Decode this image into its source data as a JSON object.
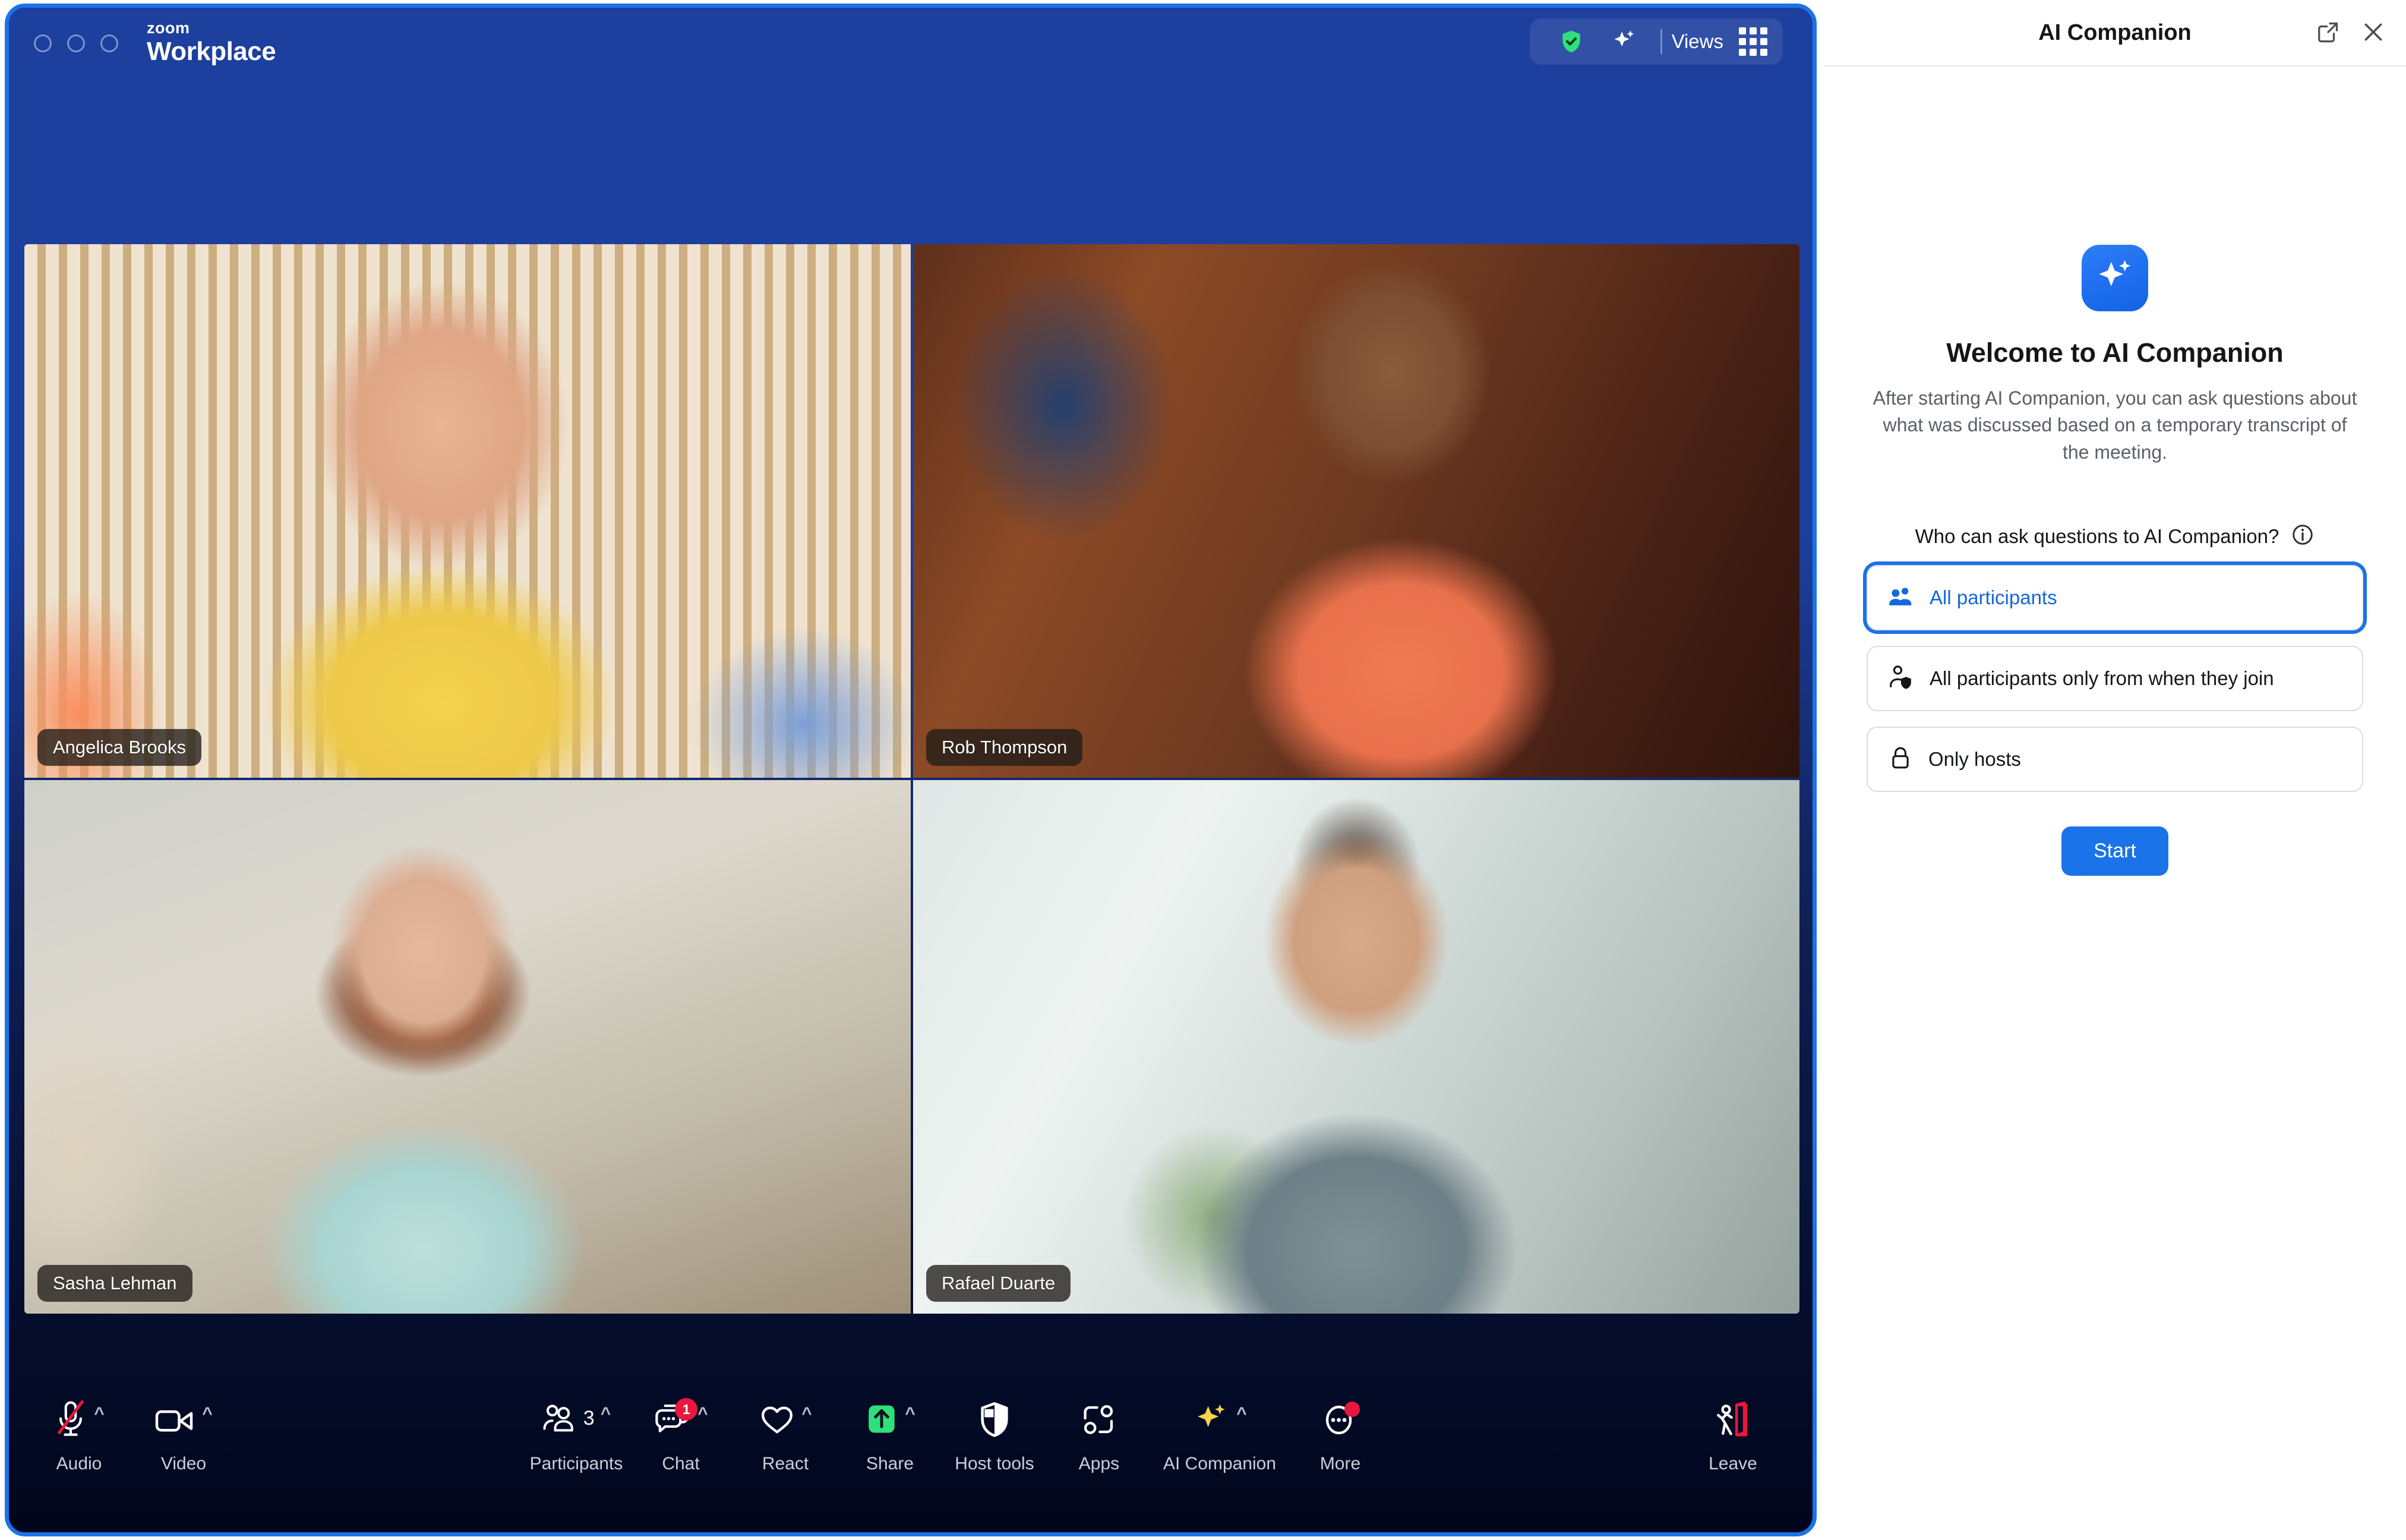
{
  "window": {
    "brand_top": "zoom",
    "brand_bottom": "Workplace",
    "titlebar_right": {
      "shield_icon": "shield-check-icon",
      "sparkle_icon": "ai-sparkle-icon",
      "views_label": "Views",
      "grid_icon": "grid-layout-icon"
    },
    "accent_border": "#1a73e8"
  },
  "participants_grid": [
    {
      "name": "Angelica Brooks",
      "scene": "scene-angelica"
    },
    {
      "name": "Rob Thompson",
      "scene": "scene-rob"
    },
    {
      "name": "Sasha Lehman",
      "scene": "scene-sasha"
    },
    {
      "name": "Rafael Duarte",
      "scene": "scene-rafael"
    }
  ],
  "toolbar": {
    "left": [
      {
        "label": "Audio",
        "icon": "microphone-muted-icon",
        "chevron": true
      },
      {
        "label": "Video",
        "icon": "video-camera-icon",
        "chevron": true
      }
    ],
    "center": [
      {
        "label": "Participants",
        "icon": "participants-icon",
        "chevron": true,
        "count": "3"
      },
      {
        "label": "Chat",
        "icon": "chat-bubble-icon",
        "chevron": true,
        "badge": "1"
      },
      {
        "label": "React",
        "icon": "heart-icon",
        "chevron": true
      },
      {
        "label": "Share",
        "icon": "share-screen-icon",
        "chevron": true
      },
      {
        "label": "Host tools",
        "icon": "shield-host-icon",
        "chevron": false
      },
      {
        "label": "Apps",
        "icon": "apps-icon",
        "chevron": false
      },
      {
        "label": "AI Companion",
        "icon": "ai-sparkle-icon",
        "chevron": true
      },
      {
        "label": "More",
        "icon": "more-ellipsis-icon",
        "chevron": false,
        "dot": true
      }
    ],
    "right": [
      {
        "label": "Leave",
        "icon": "leave-door-icon",
        "chevron": false
      }
    ]
  },
  "ai_panel": {
    "title": "AI Companion",
    "open_new_window_icon": "open-external-icon",
    "close_icon": "close-icon",
    "logo_icon": "ai-sparkle-icon",
    "welcome_title": "Welcome to AI Companion",
    "description": "After starting AI Companion, you can ask questions about what was discussed based on a temporary transcript of the meeting.",
    "question_label": "Who can ask questions to AI Companion?",
    "info_icon": "info-icon",
    "options": [
      {
        "label": "All participants",
        "icon": "two-people-icon",
        "selected": true
      },
      {
        "label": "All participants only from when they join",
        "icon": "person-shield-icon",
        "selected": false
      },
      {
        "label": "Only hosts",
        "icon": "lock-icon",
        "selected": false
      }
    ],
    "start_label": "Start",
    "accent_color": "#1a73e8"
  }
}
